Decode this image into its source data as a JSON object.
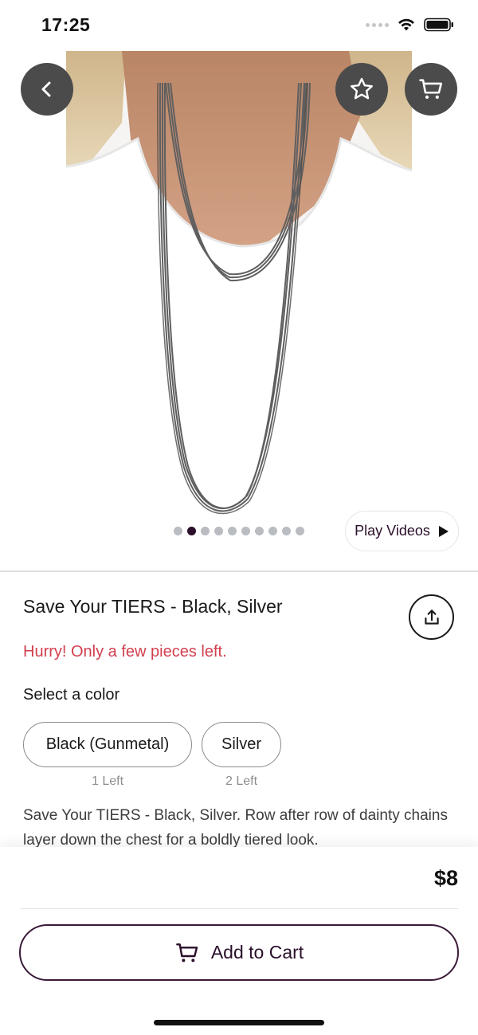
{
  "status": {
    "time": "17:25"
  },
  "hero": {
    "dots_count": 10,
    "active_dot": 1,
    "play_videos_label": "Play Videos"
  },
  "product": {
    "title": "Save Your TIERS - Black, Silver",
    "urgency": "Hurry! Only a few pieces left.",
    "select_color_label": "Select a color",
    "colors": [
      {
        "label": "Black (Gunmetal)",
        "stock": "1 Left"
      },
      {
        "label": "Silver",
        "stock": "2 Left"
      }
    ],
    "description": "Save Your TIERS - Black, Silver. Row after row of dainty chains layer down the chest for a boldly tiered look."
  },
  "purchase": {
    "price": "$8",
    "add_to_cart_label": "Add to Cart"
  },
  "colors": {
    "accent": "#2a0f2a",
    "urgency": "#d2404f",
    "overlay_button": "#4b4b4b"
  }
}
